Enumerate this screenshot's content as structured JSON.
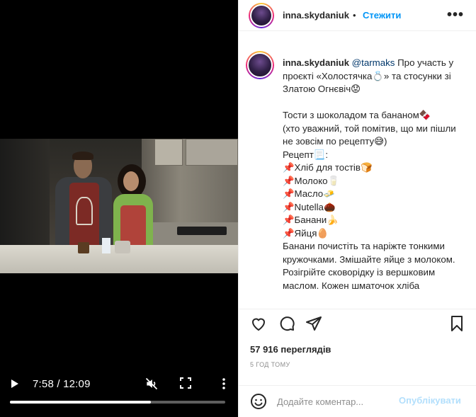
{
  "video": {
    "time": "7:58 / 12:09",
    "progress": 0.656
  },
  "header": {
    "username": "inna.skydaniuk",
    "separator": "•",
    "follow_label": "Стежити",
    "more": "•••"
  },
  "caption": {
    "username": "inna.skydaniuk",
    "mention": "@tarmaks",
    "body": " Про участь у проєкті «Холостячка💍» та стосунки зі Златою Огнєвіч😟\n\nТости з шоколадом та бананом🍫\n(хто уважний, той помітив, що ми пішли не зовсім по рецепту😅)\nРецепт📃:\n📌Хліб для тостів🍞\n📌Молоко🥛\n📌Масло🧈\n📌Nutella🌰\n📌Банани🍌\n📌Яйця🥚\nБанани почистіть та наріжте тонкими кружочками. Змішайте яйце з молоком.\nРозігрійте сковорідку із вершковим маслом. Кожен шматочок хліба"
  },
  "stats": {
    "views": "57 916 переглядів",
    "posted": "5 ГОД ТОМУ"
  },
  "comment": {
    "placeholder": "Додайте коментар...",
    "publish_label": "Опублікувати"
  },
  "colors": {
    "follow": "#0095f6",
    "publish_disabled": "#b2dffc",
    "mention": "#00376b"
  }
}
